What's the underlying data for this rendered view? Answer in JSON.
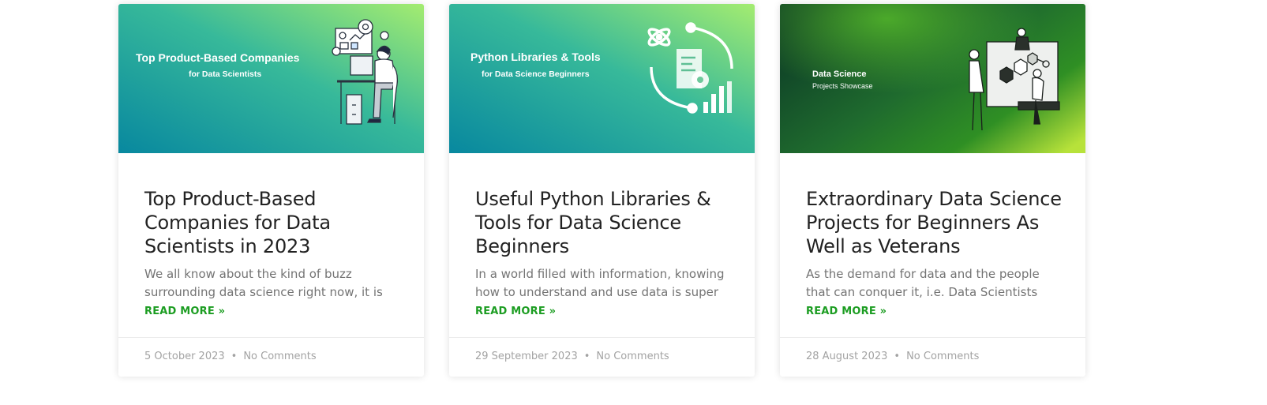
{
  "posts": [
    {
      "thumb_title": "Top Product-Based Companies",
      "thumb_subtitle": "for Data Scientists",
      "title": "Top Product-Based Companies for Data Scientists in 2023",
      "excerpt": "We all know about the kind of buzz surrounding data science right now, it is",
      "read_more": "READ MORE »",
      "date": "5 October 2023",
      "separator": "•",
      "comments": "No Comments"
    },
    {
      "thumb_title": "Python Libraries & Tools",
      "thumb_subtitle": "for Data Science Beginners",
      "title": "Useful Python Libraries & Tools for Data Science Beginners",
      "excerpt": "In a world filled with information, knowing how to understand and use data is super",
      "read_more": "READ MORE »",
      "date": "29 September 2023",
      "separator": "•",
      "comments": "No Comments"
    },
    {
      "thumb_title": "Data Science",
      "thumb_subtitle": "Projects Showcase",
      "title": "Extraordinary Data Science Projects for Beginners As Well as Veterans",
      "excerpt": "As the demand for data and the people that can conquer it, i.e. Data Scientists",
      "read_more": "READ MORE »",
      "date": "28 August 2023",
      "separator": "•",
      "comments": "No Comments"
    }
  ],
  "colors": {
    "accent_green": "#1c9d22",
    "teal": "#0b93a8",
    "lime": "#9be86f",
    "dark_green": "#0f3d1f"
  },
  "icons": [
    "person-at-desk-illustration",
    "science-tools-icon",
    "team-dashboard-illustration"
  ]
}
